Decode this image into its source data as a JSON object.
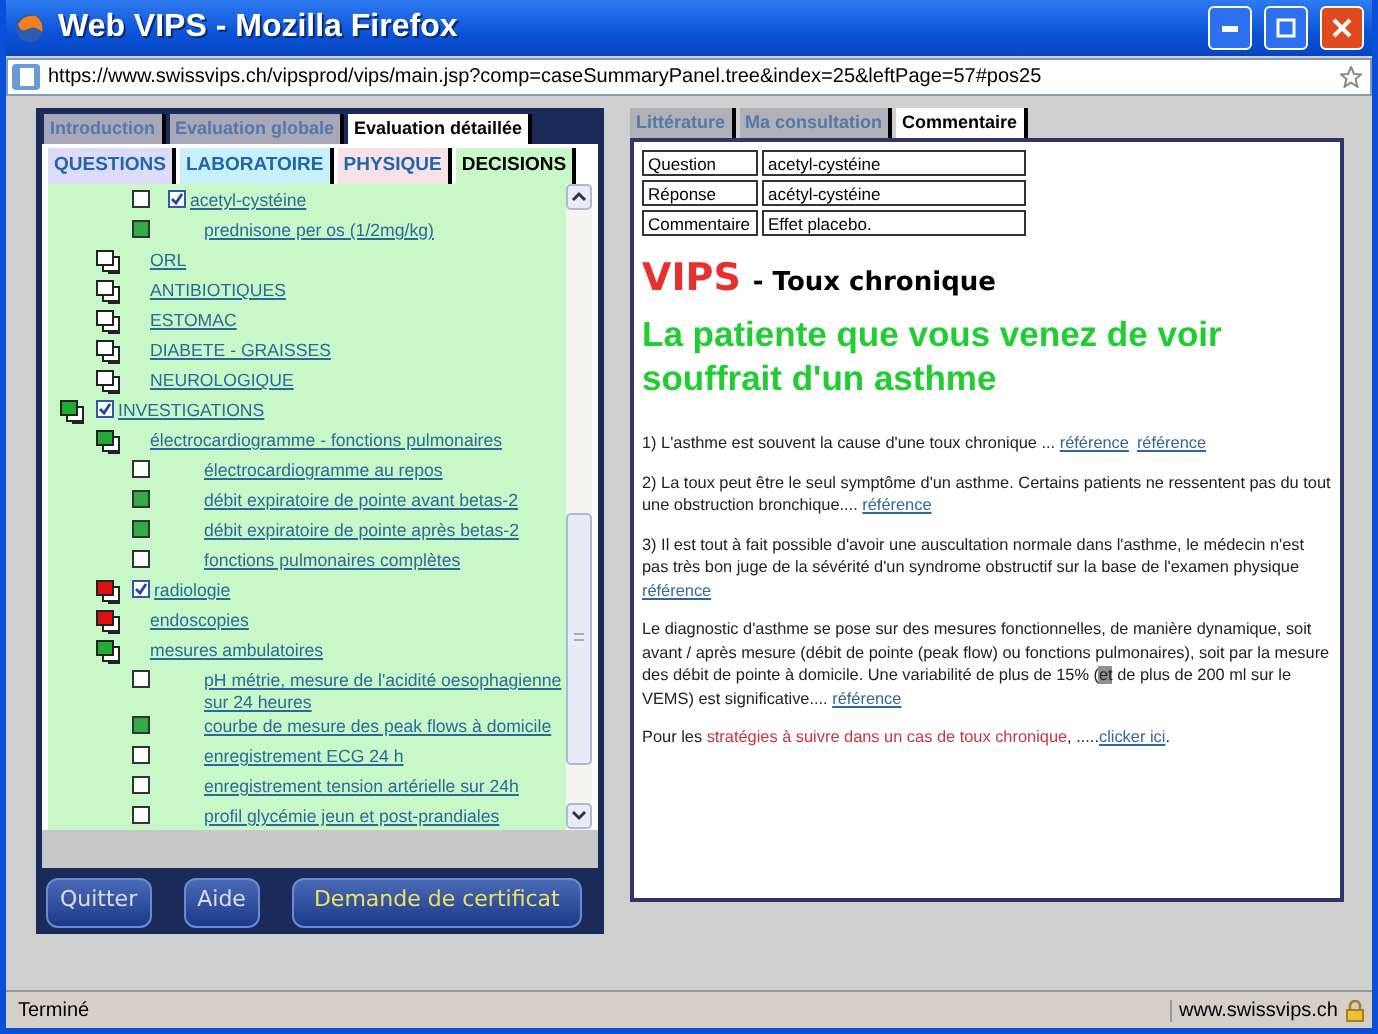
{
  "window": {
    "title": "Web VIPS - Mozilla Firefox"
  },
  "address_bar": {
    "url": "https://www.swissvips.ch/vipsprod/vips/main.jsp?comp=caseSummaryPanel.tree&index=25&leftPage=57#pos25"
  },
  "left_tabs": [
    {
      "label": "Introduction",
      "selected": false
    },
    {
      "label": "Evaluation globale",
      "selected": false
    },
    {
      "label": "Evaluation détaillée",
      "selected": true
    }
  ],
  "sub_tabs": [
    {
      "label": "QUESTIONS",
      "selected": false,
      "color": "#dcdcf8"
    },
    {
      "label": "LABORATOIRE",
      "selected": false,
      "color": "#c8f0f8"
    },
    {
      "label": "PHYSIQUE",
      "selected": false,
      "color": "#f8e2ea"
    },
    {
      "label": "DECISIONS",
      "selected": true,
      "color": "#c8f8c8"
    }
  ],
  "tree": [
    {
      "children": [
        {
          "children": [
            {
              "kind": "item",
              "color": "#ffffff",
              "label": "acetyl-cystéine",
              "checked": true
            },
            {
              "kind": "item",
              "color": "#33aa44",
              "label": "prednisone per os (1/2mg/kg)"
            }
          ]
        },
        {
          "kind": "group",
          "color": "#ffffff",
          "label": "ORL"
        },
        {
          "kind": "group",
          "color": "#ffffff",
          "label": "ANTIBIOTIQUES"
        },
        {
          "kind": "group",
          "color": "#ffffff",
          "label": "ESTOMAC"
        },
        {
          "kind": "group",
          "color": "#ffffff",
          "label": "DIABETE - GRAISSES"
        },
        {
          "kind": "group",
          "color": "#ffffff",
          "label": "NEUROLOGIQUE"
        }
      ]
    },
    {
      "kind": "group",
      "color": "#22aa33",
      "label": "INVESTIGATIONS",
      "checked": true,
      "children": [
        {
          "kind": "group",
          "color": "#22aa33",
          "label": "électrocardiogramme - fonctions pulmonaires",
          "children": [
            {
              "kind": "item",
              "color": "#ffffff",
              "label": "électrocardiogramme au repos"
            },
            {
              "kind": "item",
              "color": "#33aa44",
              "label": "débit expiratoire de pointe avant betas-2"
            },
            {
              "kind": "item",
              "color": "#33aa44",
              "label": "débit expiratoire de pointe après betas-2"
            },
            {
              "kind": "item",
              "color": "#ffffff",
              "label": "fonctions pulmonaires complètes"
            }
          ]
        },
        {
          "kind": "group",
          "color": "#dd1111",
          "label": "radiologie",
          "checked": true
        },
        {
          "kind": "group",
          "color": "#dd1111",
          "label": "endoscopies"
        },
        {
          "kind": "group",
          "color": "#22aa33",
          "label": "mesures ambulatoires",
          "children": [
            {
              "kind": "item",
              "color": "#ffffff",
              "label": "pH métrie, mesure de l'acidité oesophagienne sur 24 heures"
            },
            {
              "kind": "item",
              "color": "#33aa44",
              "label": "courbe de mesure des peak flows à domicile"
            },
            {
              "kind": "item",
              "color": "#ffffff",
              "label": "enregistrement ECG 24 h"
            },
            {
              "kind": "item",
              "color": "#ffffff",
              "label": "enregistrement tension artérielle sur 24h"
            },
            {
              "kind": "item",
              "color": "#ffffff",
              "label": "profil glycémie jeun et post-prandiales"
            }
          ]
        }
      ]
    }
  ],
  "buttons": [
    "Quitter",
    "Aide",
    "Demande de certificat"
  ],
  "right_tabs": [
    {
      "label": "Littérature",
      "selected": false
    },
    {
      "label": "Ma consultation",
      "selected": false
    },
    {
      "label": "Commentaire",
      "selected": true
    }
  ],
  "summary_table": [
    {
      "label": "Question",
      "value": "acetyl-cystéine"
    },
    {
      "label": "Réponse",
      "value": "acétyl-cystéine"
    },
    {
      "label": "Commentaire",
      "value": "Effet placebo."
    }
  ],
  "title": {
    "brand": "VIPS",
    "subtitle": "- Toux chronique"
  },
  "heading": "La patiente que vous venez de voir souffrait d'un asthme",
  "paragraphs": [
    [
      {
        "kind": "text",
        "text": "1) L'asthme est souvent la cause d'une toux chronique ... "
      },
      {
        "kind": "link",
        "text": "référence"
      },
      {
        "kind": "link",
        "text": "référence"
      }
    ],
    [
      {
        "kind": "text",
        "text": "2) La toux peut être le seul symptôme d'un asthme. Certains patients ne ressentent pas du tout une obstruction bronchique.... "
      },
      {
        "kind": "link",
        "text": "référence"
      }
    ],
    [
      {
        "kind": "text",
        "text": "3) Il est tout à fait possible d'avoir une auscultation normale dans l'asthme, le médecin n'est pas très bon juge de la sévérité d'un syndrome obstructif sur la base de l'examen physique "
      },
      {
        "kind": "link",
        "text": "référence"
      }
    ],
    [
      {
        "kind": "text",
        "text": "Le diagnostic d'asthme se pose sur des mesures fonctionnelles, de manière dynamique, soit avant / après mesure (débit de pointe (peak flow) ou fonctions pulmonaires), soit par la mesure des débit de pointe à domicile. Une variabilité de plus de 15% ("
      },
      {
        "kind": "highlight",
        "text": "et"
      },
      {
        "kind": "text",
        "text": " de plus de 200 ml sur le VEMS) est significative.... "
      },
      {
        "kind": "link",
        "text": "référence"
      }
    ],
    [
      {
        "kind": "text",
        "text": "Pour les "
      },
      {
        "kind": "red",
        "text": "stratégies à suivre dans un cas de toux chronique"
      },
      {
        "kind": "text",
        "text": ", ....."
      },
      {
        "kind": "link",
        "text": "clicker ici"
      },
      {
        "kind": "text",
        "text": "."
      }
    ]
  ],
  "status_bar": {
    "text": "Terminé",
    "domain": "www.swissvips.ch"
  }
}
